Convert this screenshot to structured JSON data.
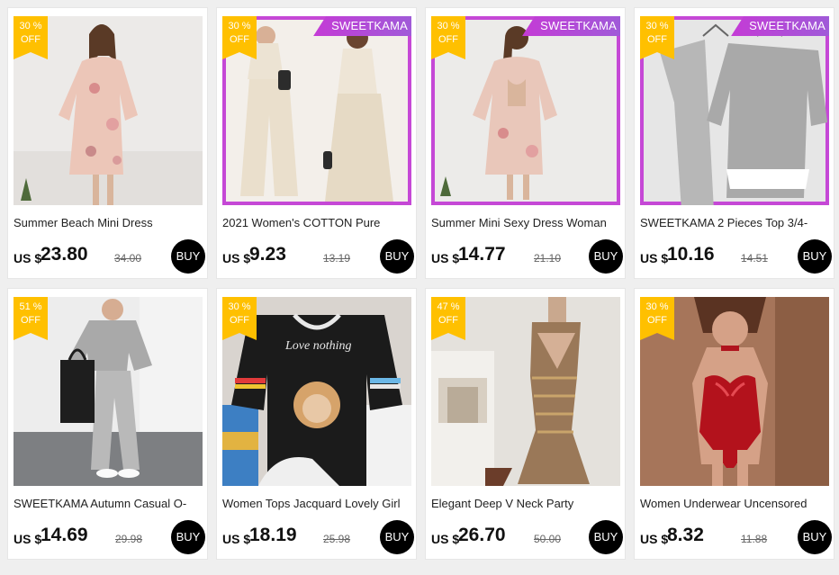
{
  "currency_label": "US $",
  "buy_label": "BUY",
  "brand_tag_color": "#b54bd8",
  "badge_color": "#ffc000",
  "products": [
    {
      "discount_pct": "30 %",
      "off_label": "OFF",
      "brand_tag": "",
      "title": "Summer Beach Mini Dress",
      "price": "23.80",
      "original_price": "34.00",
      "image_icon": "floral-mini-dress-photo"
    },
    {
      "discount_pct": "30 %",
      "off_label": "OFF",
      "brand_tag": "SWEETKAMA",
      "title": "2021 Women's COTTON Pure",
      "price": "9.23",
      "original_price": "13.19",
      "image_icon": "cream-two-piece-set-photo"
    },
    {
      "discount_pct": "30 %",
      "off_label": "OFF",
      "brand_tag": "SWEETKAMA",
      "title": "Summer Mini Sexy Dress Woman",
      "price": "14.77",
      "original_price": "21.10",
      "image_icon": "floral-dress-back-photo"
    },
    {
      "discount_pct": "30 %",
      "off_label": "OFF",
      "brand_tag": "SWEETKAMA",
      "title": "SWEETKAMA 2 Pieces Top 3/4-",
      "price": "10.16",
      "original_price": "14.51",
      "image_icon": "grey-two-piece-hanger-photo"
    },
    {
      "discount_pct": "51 %",
      "off_label": "OFF",
      "brand_tag": "",
      "title": "SWEETKAMA Autumn Casual O-",
      "price": "14.69",
      "original_price": "29.98",
      "image_icon": "grey-casual-set-photo"
    },
    {
      "discount_pct": "30 %",
      "off_label": "OFF",
      "brand_tag": "",
      "title": "Women Tops Jacquard Lovely Girl",
      "price": "18.19",
      "original_price": "25.98",
      "image_icon": "black-jacquard-top-photo"
    },
    {
      "discount_pct": "47 %",
      "off_label": "OFF",
      "brand_tag": "",
      "title": "Elegant Deep V Neck Party",
      "price": "26.70",
      "original_price": "50.00",
      "image_icon": "sequin-gown-photo"
    },
    {
      "discount_pct": "30 %",
      "off_label": "OFF",
      "brand_tag": "",
      "title": "Women Underwear Uncensored",
      "price": "8.32",
      "original_price": "11.88",
      "image_icon": "red-bodysuit-photo"
    }
  ]
}
